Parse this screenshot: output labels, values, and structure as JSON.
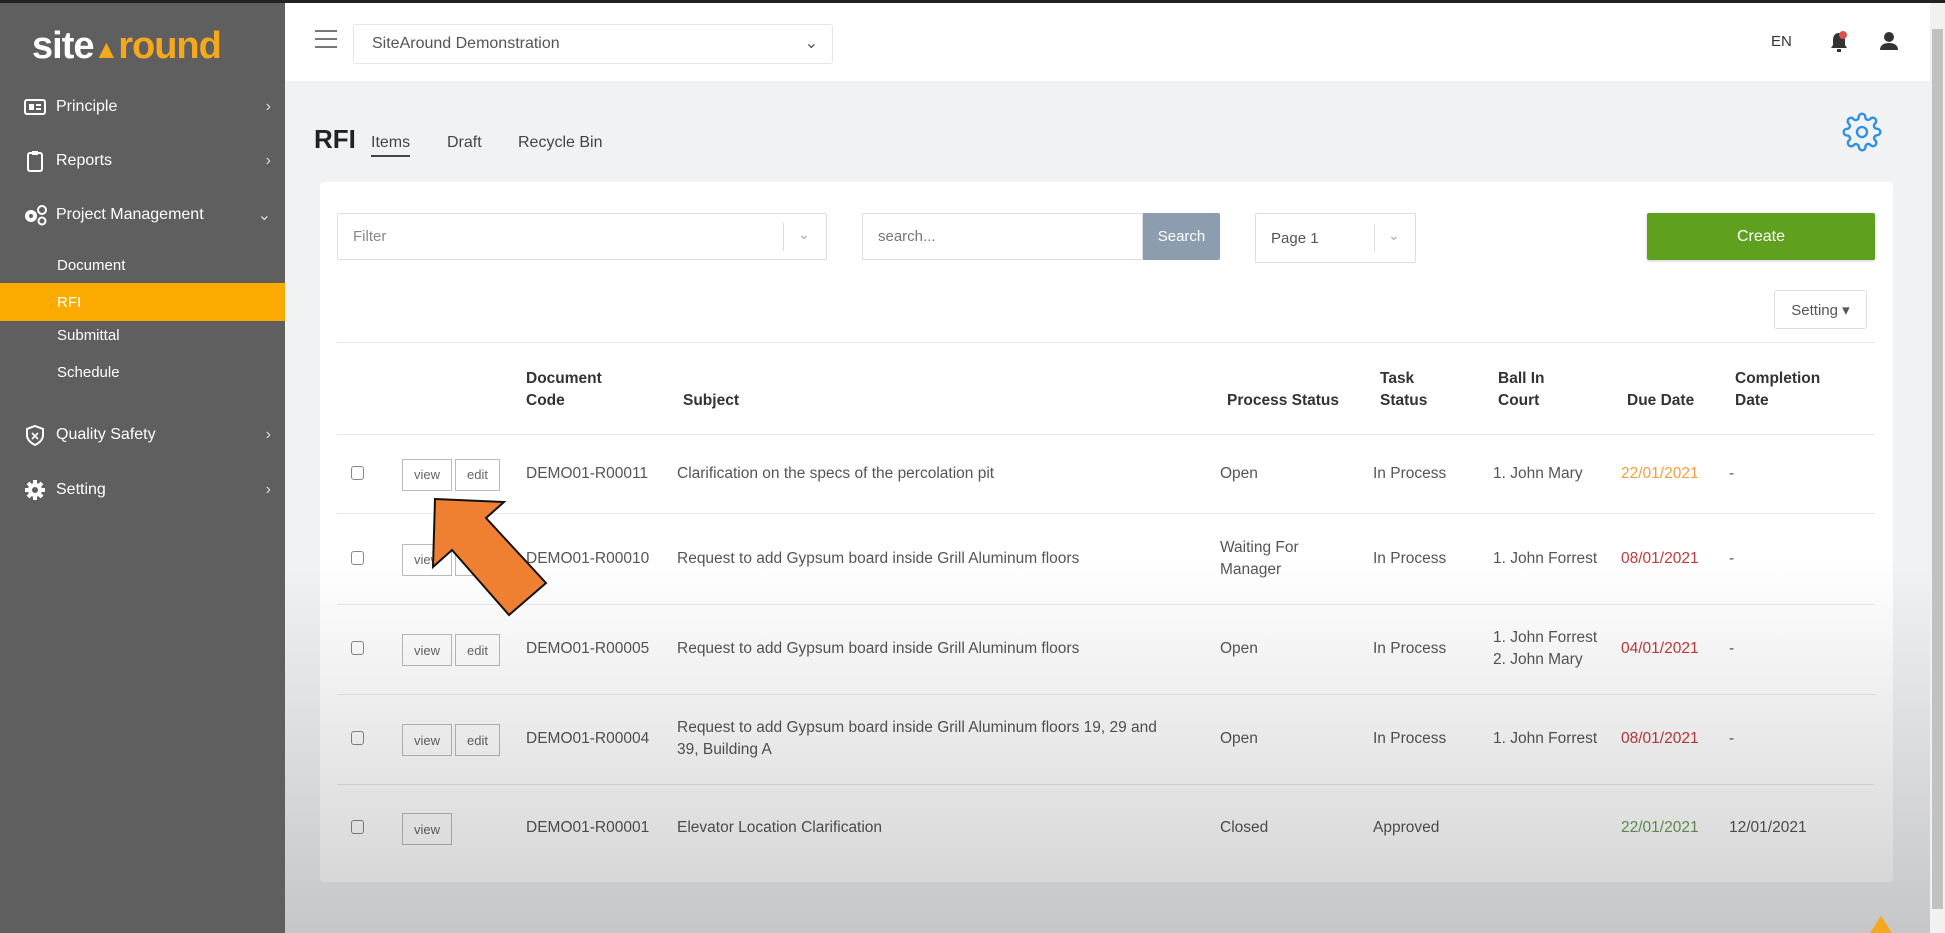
{
  "brand": {
    "part1": "site",
    "part2": "round",
    "accent": "#f5a81c"
  },
  "sidebar": {
    "items": [
      {
        "label": "Principle",
        "icon": "id-card-icon"
      },
      {
        "label": "Reports",
        "icon": "clipboard-icon"
      },
      {
        "label": "Project Management",
        "icon": "cogs-icon"
      },
      {
        "label": "Quality Safety",
        "icon": "shield-icon"
      },
      {
        "label": "Setting",
        "icon": "gear-icon"
      }
    ],
    "subitems": [
      "Document",
      "RFI",
      "Submittal",
      "Schedule"
    ],
    "active": "RFI"
  },
  "header": {
    "project": "SiteAround Demonstration",
    "lang": "EN"
  },
  "page": {
    "title": "RFI",
    "tabs": [
      "Items",
      "Draft",
      "Recycle Bin"
    ]
  },
  "toolbar": {
    "filter_placeholder": "Filter",
    "search_placeholder": "search...",
    "search_label": "Search",
    "page": "Page 1",
    "create_label": "Create",
    "setting_label": "Setting ▾"
  },
  "table": {
    "headers": {
      "code": [
        "Document",
        "Code"
      ],
      "subject": "Subject",
      "process": "Process Status",
      "task": [
        "Task",
        "Status"
      ],
      "ball": [
        "Ball In",
        "Court"
      ],
      "due": "Due Date",
      "completion": [
        "Completion",
        "Date"
      ]
    },
    "view_label": "view",
    "edit_label": "edit",
    "rows": [
      {
        "code": "DEMO01-R00011",
        "subject": [
          "Clarification on the specs of the percolation pit"
        ],
        "process": [
          "Open"
        ],
        "task": "In Process",
        "ball": [
          "1. John Mary"
        ],
        "due": "22/01/2021",
        "due_color": "#f0a040",
        "completion": "-",
        "editable": true
      },
      {
        "code": "DEMO01-R00010",
        "subject": [
          "Request to add Gypsum board inside Grill Aluminum floors"
        ],
        "process": [
          "Waiting For",
          "Manager"
        ],
        "task": "In Process",
        "ball": [
          "1. John Forrest"
        ],
        "due": "08/01/2021",
        "due_color": "#c0393b",
        "completion": "-",
        "editable": true
      },
      {
        "code": "DEMO01-R00005",
        "subject": [
          "Request to add Gypsum board inside Grill Aluminum floors"
        ],
        "process": [
          "Open"
        ],
        "task": "In Process",
        "ball": [
          "1. John Forrest",
          "2. John Mary"
        ],
        "due": "04/01/2021",
        "due_color": "#c0393b",
        "completion": "-",
        "editable": true
      },
      {
        "code": "DEMO01-R00004",
        "subject": [
          "Request to add Gypsum board inside Grill Aluminum floors 19, 29 and",
          "39, Building A"
        ],
        "process": [
          "Open"
        ],
        "task": "In Process",
        "ball": [
          "1. John Forrest"
        ],
        "due": "08/01/2021",
        "due_color": "#c0393b",
        "completion": "-",
        "editable": true
      },
      {
        "code": "DEMO01-R00001",
        "subject": [
          "Elevator Location Clarification"
        ],
        "process": [
          "Closed"
        ],
        "task": "Approved",
        "ball": [],
        "due": "22/01/2021",
        "due_color": "#6a9a5a",
        "completion": "12/01/2021",
        "editable": false
      }
    ]
  }
}
